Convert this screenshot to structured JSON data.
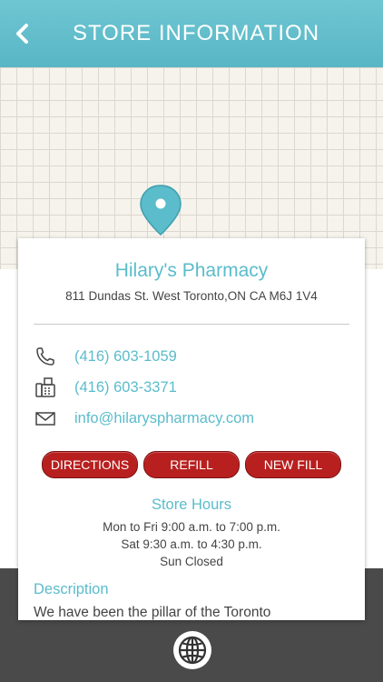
{
  "header": {
    "title": "STORE INFORMATION"
  },
  "store": {
    "name": "Hilary's Pharmacy",
    "address": "811 Dundas St. West Toronto,ON CA M6J 1V4"
  },
  "contacts": {
    "phone": "(416) 603-1059",
    "fax": "(416) 603-3371",
    "email": "info@hilaryspharmacy.com"
  },
  "actions": {
    "directions": "DIRECTIONS",
    "refill": "REFILL",
    "new_fill": "NEW FILL"
  },
  "hours": {
    "title": "Store Hours",
    "lines": [
      "Mon to Fri 9:00 a.m. to 7:00 p.m.",
      "Sat 9:30 a.m. to 4:30 p.m.",
      "Sun Closed"
    ]
  },
  "description": {
    "title": "Description",
    "text": "We have been the pillar of the Toronto"
  },
  "colors": {
    "accent": "#5bbccb",
    "header": "#6fc6d2",
    "button": "#b8201f",
    "bottom_bar": "#4a4a4a"
  },
  "icons": {
    "back": "chevron-left-icon",
    "pin": "map-pin-icon",
    "phone": "phone-icon",
    "fax": "fax-icon",
    "email": "envelope-icon",
    "globe": "globe-icon"
  }
}
